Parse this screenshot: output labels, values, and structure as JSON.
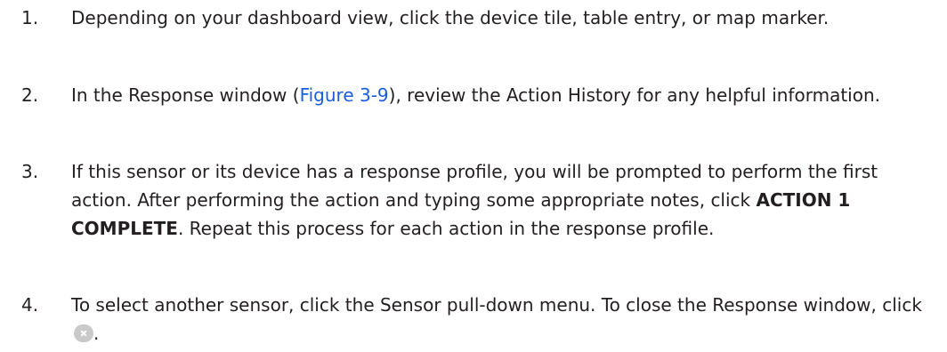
{
  "steps": [
    {
      "number": "1.",
      "text": "Depending on your dashboard view, click the device tile, table entry, or map marker."
    },
    {
      "number": "2.",
      "text_before": "In the Response window (",
      "link": "Figure 3-9",
      "text_after": "), review the Action History for any helpful information."
    },
    {
      "number": "3.",
      "text_before": "If this sensor or its device has a response profile, you will be prompted to perform the first action. After performing the action and typing some appropriate notes, click ",
      "bold": "ACTION 1 COMPLETE",
      "text_after": ". Repeat this process for each action in the response profile."
    },
    {
      "number": "4.",
      "text_before": "To select another sensor, click the Sensor pull-down menu. To close the Response window, click ",
      "icon": "close-icon",
      "text_after": "."
    }
  ],
  "colors": {
    "text": "#231f20",
    "link": "#1a5edb",
    "close_button": "#c9c9c9"
  }
}
